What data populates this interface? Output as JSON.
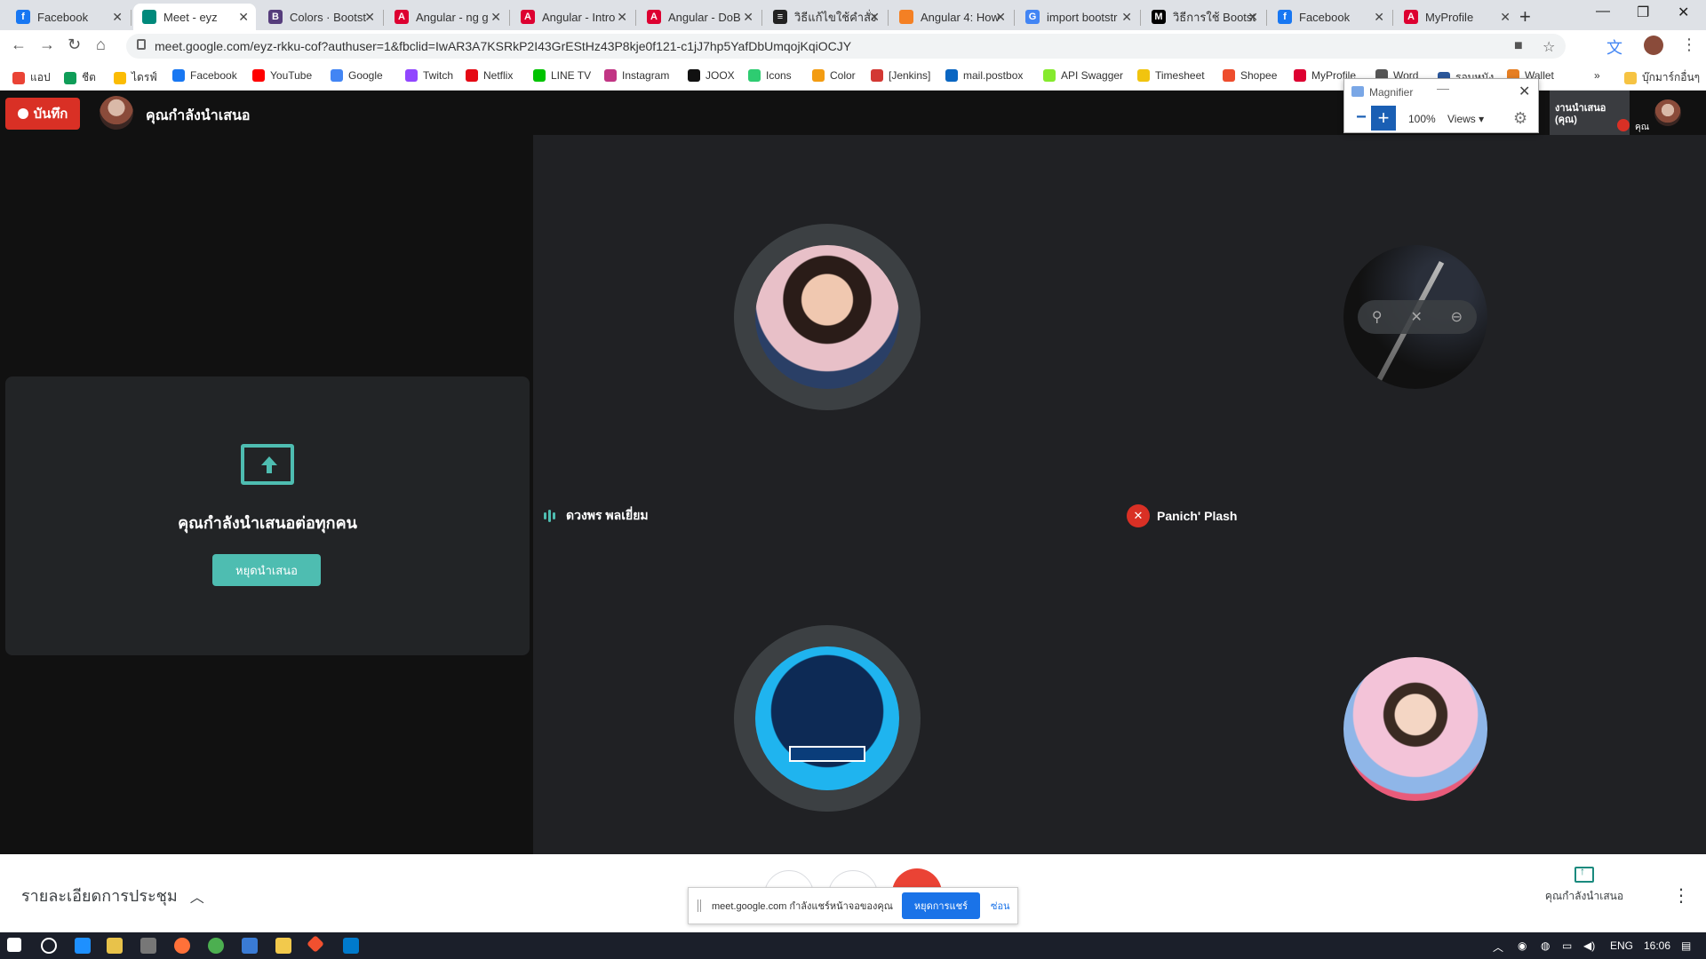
{
  "browser": {
    "tabs": [
      {
        "title": "Facebook",
        "color": "#1877f2",
        "glyph": "f"
      },
      {
        "title": "Meet - eyz",
        "color": "#00897b",
        "glyph": "",
        "active": true
      },
      {
        "title": "Colors · Bootst",
        "color": "#563d7c",
        "glyph": "B"
      },
      {
        "title": "Angular - ng g",
        "color": "#dd0031",
        "glyph": "A"
      },
      {
        "title": "Angular - Intro",
        "color": "#dd0031",
        "glyph": "A"
      },
      {
        "title": "Angular - DoB",
        "color": "#dd0031",
        "glyph": "A"
      },
      {
        "title": "วิธีแก้ไขใช้คำสั่ง",
        "color": "#222222",
        "glyph": "≡"
      },
      {
        "title": "Angular 4: How",
        "color": "#f48024",
        "glyph": ""
      },
      {
        "title": "import bootstr",
        "color": "#4285f4",
        "glyph": "G"
      },
      {
        "title": "วิธีการใช้ Bootst",
        "color": "#000000",
        "glyph": "M"
      },
      {
        "title": "Facebook",
        "color": "#1877f2",
        "glyph": "f"
      },
      {
        "title": "MyProfile",
        "color": "#dd0031",
        "glyph": "A"
      }
    ],
    "new_tab": "+",
    "close_glyph": "✕",
    "url": "meet.google.com/eyz-rkku-cof?authuser=1&fbclid=IwAR3A7KSRkP2I43GrEStHz43P8kje0f121-c1jJ7hp5YafDbUmqojKqiOCJY",
    "bookmarks": [
      {
        "label": "แอป",
        "color": "#ea4335"
      },
      {
        "label": "ชีต",
        "color": "#0f9d58"
      },
      {
        "label": "ไดรฟ์",
        "color": "#fbbc04"
      },
      {
        "label": "Facebook",
        "color": "#1877f2"
      },
      {
        "label": "YouTube",
        "color": "#ff0000"
      },
      {
        "label": "Google",
        "color": "#4285f4"
      },
      {
        "label": "Twitch",
        "color": "#9146ff"
      },
      {
        "label": "Netflix",
        "color": "#e50914"
      },
      {
        "label": "LINE TV",
        "color": "#00c300"
      },
      {
        "label": "Instagram",
        "color": "#c13584"
      },
      {
        "label": "JOOX",
        "color": "#111111"
      },
      {
        "label": "Icons",
        "color": "#2ecc71"
      },
      {
        "label": "Color",
        "color": "#f39c12"
      },
      {
        "label": "[Jenkins]",
        "color": "#d33833"
      },
      {
        "label": "mail.postbox",
        "color": "#0a66c2"
      },
      {
        "label": "API Swagger",
        "color": "#85ea2d"
      },
      {
        "label": "Timesheet",
        "color": "#f1c40f"
      },
      {
        "label": "Shopee",
        "color": "#ee4d2d"
      },
      {
        "label": "MyProfile",
        "color": "#dd0031"
      },
      {
        "label": "Word",
        "color": "#555555"
      },
      {
        "label": "รอบหนัง",
        "color": "#2b579a"
      },
      {
        "label": "Wallet",
        "color": "#e67e22"
      },
      {
        "label": "บุ๊กมาร์กอื่นๆ",
        "color": "#f6c342"
      }
    ]
  },
  "meet": {
    "record_label": "บันทึก",
    "presenting_title": "คุณกำลังนำเสนอ",
    "card": {
      "text": "คุณกำลังนำเสนอต่อทุกคน",
      "stop_label": "หยุดนำเสนอ"
    },
    "participants": [
      {
        "name": "ดวงพร พลเยี่ยม",
        "speaking": true
      },
      {
        "name": "Panich' Plash",
        "muted": true
      }
    ],
    "self_tile": {
      "label": "งานนำเสนอ (คุณ)",
      "you": "คุณ"
    },
    "bottom": {
      "details": "รายละเอียดการประชุม",
      "present_label": "คุณกำลังนำเสนอ"
    },
    "share_bar": {
      "message": "meet.google.com กำลังแชร์หน้าจอของคุณ",
      "stop": "หยุดการแชร์",
      "hide": "ซ่อน"
    }
  },
  "magnifier": {
    "title": "Magnifier",
    "zoom": "100%",
    "views": "Views ▾"
  },
  "taskbar": {
    "language": "ENG",
    "time": "16:06"
  }
}
